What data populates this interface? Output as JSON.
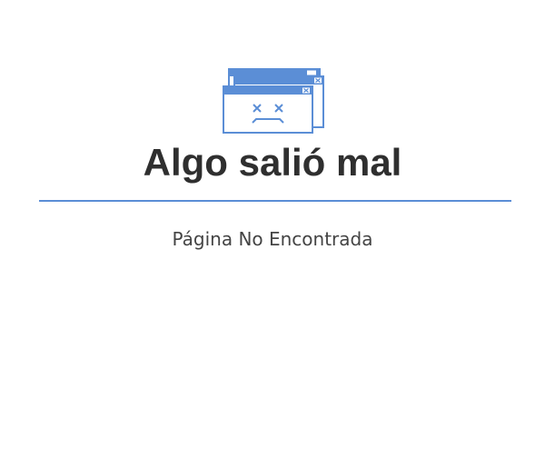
{
  "error_page": {
    "illustration_icon": "broken-window-sad-face-icon",
    "title": "Algo salió mal",
    "subtitle": "Página No Encontrada"
  },
  "colors": {
    "accent": "#5b8ed6",
    "title_text": "#2f2f2f",
    "subtitle_text": "#444444",
    "background": "#ffffff"
  }
}
